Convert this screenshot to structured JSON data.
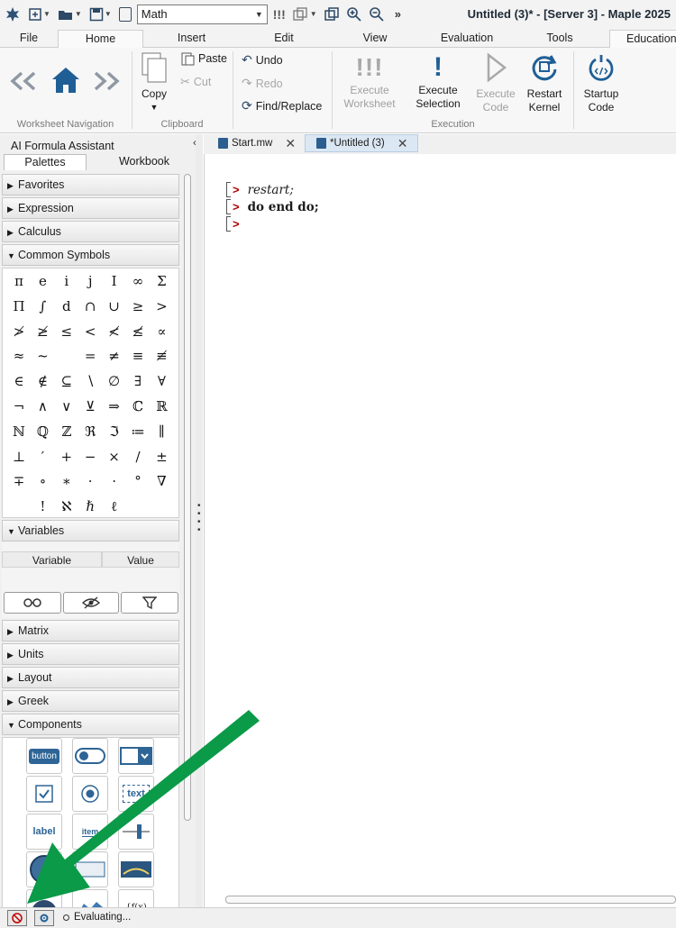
{
  "titlebar": {
    "mode": "Math",
    "title": "Untitled (3)* - [Server 3] - Maple 2025"
  },
  "ribbon_tabs": [
    "File",
    "Home",
    "Insert",
    "Edit",
    "View",
    "Evaluation",
    "Tools",
    "Education"
  ],
  "ribbon": {
    "nav_label": "Worksheet Navigation",
    "clipboard": {
      "copy": "Copy",
      "paste": "Paste",
      "cut": "Cut",
      "label": "Clipboard"
    },
    "edit": {
      "undo": "Undo",
      "redo": "Redo",
      "find_replace": "Find/Replace"
    },
    "execution": {
      "execute_worksheet": [
        "Execute",
        "Worksheet"
      ],
      "execute_selection": [
        "Execute",
        "Selection"
      ],
      "execute_code": [
        "Execute",
        "Code"
      ],
      "restart_kernel": [
        "Restart",
        "Kernel"
      ],
      "label": "Execution"
    },
    "startup_code": [
      "Startup",
      "Code"
    ]
  },
  "left_panel": {
    "assistant": "AI Formula Assistant",
    "tabs": [
      "Palettes",
      "Workbook"
    ],
    "sections_top": [
      "Favorites",
      "Expression",
      "Calculus",
      "Common Symbols"
    ],
    "symbols": [
      [
        "π",
        "e",
        "i",
        "j",
        "I",
        "∞",
        "Σ"
      ],
      [
        "Π",
        "∫",
        "d",
        "∩",
        "∪",
        "≥",
        ">"
      ],
      [
        "≯",
        "≱",
        "≤",
        "<",
        "≮",
        "≰",
        "∝"
      ],
      [
        "≈",
        "~",
        "",
        "=",
        "≠",
        "≡",
        "≢"
      ],
      [
        "∈",
        "∉",
        "⊆",
        "∖",
        "∅",
        "∃",
        "∀"
      ],
      [
        "¬",
        "∧",
        "∨",
        "⊻",
        "⇒",
        "ℂ",
        "ℝ"
      ],
      [
        "ℕ",
        "ℚ",
        "ℤ",
        "ℜ",
        "ℑ",
        "≔",
        "∥"
      ],
      [
        "⊥",
        "′",
        "+",
        "−",
        "×",
        "/",
        "±"
      ],
      [
        "∓",
        "∘",
        "∗",
        "·",
        "·",
        "°",
        "∇"
      ],
      [
        "",
        "!",
        "ℵ",
        "ℏ",
        "ℓ",
        "",
        ""
      ]
    ],
    "variables": {
      "header": "Variables",
      "col_variable": "Variable",
      "col_value": "Value"
    },
    "sections_bottom": [
      "Matrix",
      "Units",
      "Layout",
      "Greek",
      "Components"
    ],
    "components": {
      "button": "button",
      "text": "text",
      "label": "label",
      "item": "item"
    }
  },
  "doc_tabs": [
    "Start.mw",
    "*Untitled (3)"
  ],
  "worksheet": {
    "lines": [
      "restart;",
      "do end do;",
      ""
    ]
  },
  "status": {
    "text": "Evaluating..."
  },
  "colors": {
    "prompt": "#b00000",
    "arrow": "#0a9a48",
    "home_icon": "#1f5f96"
  }
}
